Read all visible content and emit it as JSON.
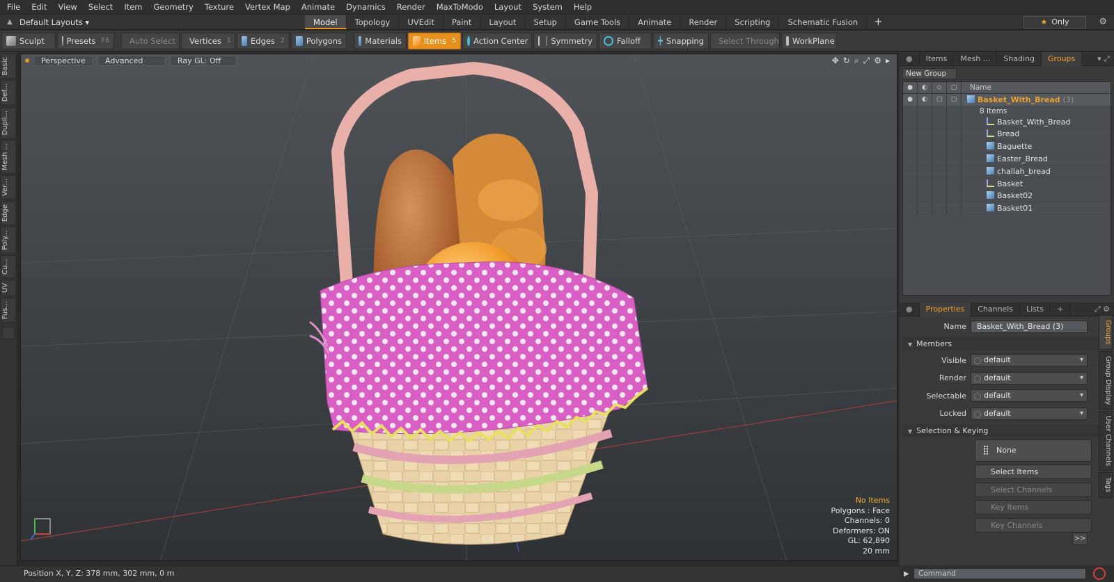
{
  "menu": [
    "File",
    "Edit",
    "View",
    "Select",
    "Item",
    "Geometry",
    "Texture",
    "Vertex Map",
    "Animate",
    "Dynamics",
    "Render",
    "MaxToModo",
    "Layout",
    "System",
    "Help"
  ],
  "layout": {
    "dropdown": "Default Layouts ▾",
    "tabs": [
      "Model",
      "Topology",
      "UVEdit",
      "Paint",
      "Layout",
      "Setup",
      "Game Tools",
      "Animate",
      "Render",
      "Scripting",
      "Schematic Fusion"
    ],
    "active_tab": "Model",
    "only_label": "Only"
  },
  "toolbar": {
    "sculpt": "Sculpt",
    "presets": "Presets",
    "presets_key": "F6",
    "auto_select": "Auto Select",
    "vertices": "Vertices",
    "vertices_key": "1",
    "edges": "Edges",
    "edges_key": "2",
    "polygons": "Polygons",
    "materials": "Materials",
    "items": "Items",
    "items_key": "5",
    "action_center": "Action Center",
    "symmetry": "Symmetry",
    "falloff": "Falloff",
    "snapping": "Snapping",
    "select_through": "Select Through",
    "workplane": "WorkPlane"
  },
  "left_tabs": [
    "Basic",
    "Def...",
    "Dupli...",
    "Mesh ...",
    "Ver...",
    "Edge",
    "Poly...",
    "Cu...",
    "UV",
    "Fus..."
  ],
  "viewport": {
    "view": "Perspective",
    "shading": "Advanced",
    "raygl": "Ray GL: Off",
    "info": {
      "selection": "No Items",
      "polygons": "Polygons : Face",
      "channels": "Channels: 0",
      "deformers": "Deformers: ON",
      "gl": "GL: 62,890",
      "scale": "20 mm"
    }
  },
  "status": "Position X, Y, Z:  378 mm, 302 mm, 0 m",
  "groups_panel": {
    "tabs": [
      "Items",
      "Mesh ...",
      "Shading",
      "Groups"
    ],
    "active_tab": "Groups",
    "new_group": "New Group",
    "name_header": "Name",
    "group": {
      "name": "Basket_With_Bread",
      "count": "(3)",
      "sub": "8 Items"
    },
    "items": [
      {
        "name": "Basket_With_Bread",
        "kind": "locator"
      },
      {
        "name": "Bread",
        "kind": "locator"
      },
      {
        "name": "Baguette",
        "kind": "mesh"
      },
      {
        "name": "Easter_Bread",
        "kind": "mesh"
      },
      {
        "name": "challah_bread",
        "kind": "mesh"
      },
      {
        "name": "Basket",
        "kind": "locator"
      },
      {
        "name": "Basket02",
        "kind": "mesh"
      },
      {
        "name": "Basket01",
        "kind": "mesh"
      }
    ]
  },
  "properties": {
    "tabs": [
      "Properties",
      "Channels",
      "Lists"
    ],
    "active_tab": "Properties",
    "name_label": "Name",
    "name_value": "Basket_With_Bread (3)",
    "members_section": "Members",
    "visible_label": "Visible",
    "visible_value": "default",
    "render_label": "Render",
    "render_value": "default",
    "selectable_label": "Selectable",
    "selectable_value": "default",
    "locked_label": "Locked",
    "locked_value": "default",
    "keying_section": "Selection & Keying",
    "none_label": "None",
    "select_items": "Select Items",
    "select_channels": "Select Channels",
    "key_items": "Key Items",
    "key_channels": "Key Channels",
    "more": ">>"
  },
  "side_tabs": [
    "Groups",
    "Group Display",
    "User Channels",
    "Tags"
  ],
  "command_placeholder": "Command",
  "colors": {
    "accent": "#e8901e",
    "highlight_text": "#f0a030"
  }
}
